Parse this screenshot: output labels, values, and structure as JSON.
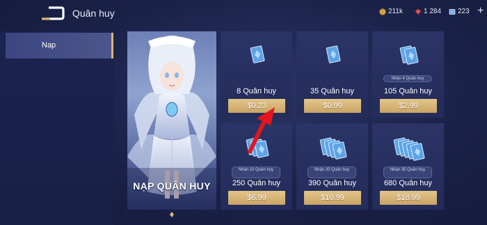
{
  "header": {
    "title": "Quân huy",
    "resources": [
      {
        "name": "gold",
        "value": "211k",
        "icon": "gold-coin-icon",
        "color": "#e8b64c"
      },
      {
        "name": "gems",
        "value": "1 284",
        "icon": "red-gem-icon",
        "color": "#e0555a"
      },
      {
        "name": "vouchers",
        "value": "223",
        "icon": "voucher-icon",
        "color": "#6f9ee8"
      }
    ],
    "add_label": "+"
  },
  "sidebar": {
    "items": [
      {
        "label": "Nạp",
        "active": true
      }
    ]
  },
  "banner": {
    "title": "NẠP QUÂN HUY"
  },
  "packs": [
    {
      "amount": "8 Quân huy",
      "price": "$0.23",
      "bonus": ""
    },
    {
      "amount": "35 Quân huy",
      "price": "$0.99",
      "bonus": ""
    },
    {
      "amount": "105 Quân huy",
      "price": "$2.99",
      "bonus": "Nhận 4 Quân huy"
    },
    {
      "amount": "250 Quân huy",
      "price": "$6.99",
      "bonus": "Nhận 10 Quân huy"
    },
    {
      "amount": "390 Quân huy",
      "price": "$10.99",
      "bonus": "Nhận 20 Quân huy"
    },
    {
      "amount": "680 Quân huy",
      "price": "$18.99",
      "bonus": "Nhận 35 Quân huy"
    }
  ],
  "colors": {
    "accent_gold": "#d8b877",
    "price_button": "#d4b372",
    "annotation_arrow": "#e3161e"
  }
}
